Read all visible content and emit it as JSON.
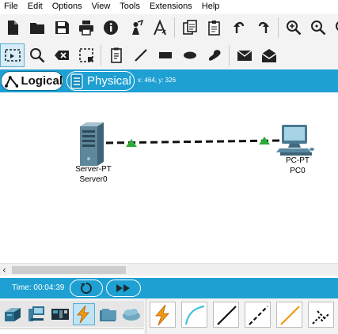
{
  "menu": [
    "File",
    "Edit",
    "Options",
    "View",
    "Tools",
    "Extensions",
    "Help"
  ],
  "toolbar_main": [
    "new-icon",
    "open-icon",
    "save-icon",
    "print-icon",
    "info-icon",
    "network-wizard-icon",
    "activity-wizard-icon",
    "copy-icon",
    "paste-icon",
    "undo-icon",
    "redo-icon",
    "zoom-in-icon",
    "zoom-reset-icon",
    "zoom-out-icon"
  ],
  "toolbar_tools": [
    "select-icon",
    "inspect-icon",
    "delete-icon",
    "resize-icon",
    "note-icon",
    "draw-line-icon",
    "draw-rectangle-icon",
    "draw-ellipse-icon",
    "draw-freeform-icon",
    "add-simple-pdu-icon",
    "add-complex-pdu-icon"
  ],
  "workspace": {
    "logical_label": "Logical",
    "physical_label": "Physical",
    "coords": "x: 464, y: 326"
  },
  "devices": [
    {
      "type": "Server-PT",
      "name": "Server0"
    },
    {
      "type": "PC-PT",
      "name": "PC0"
    }
  ],
  "link": {
    "style": "dashed",
    "color": "#111111",
    "endpoint_color": "#2eaa3a"
  },
  "time": {
    "label": "Time: 00:04:39"
  },
  "device_categories": [
    "network-devices-icon",
    "end-devices-icon",
    "components-icon",
    "connections-icon",
    "miscellaneous-icon",
    "multiuser-icon"
  ],
  "selected_category": "connections-icon",
  "cables": [
    "automatic-cable-icon",
    "console-cable-icon",
    "straight-through-cable-icon",
    "crossover-cable-icon",
    "fiber-cable-icon",
    "phone-cable-icon"
  ],
  "colors": {
    "accent": "#1ea0d2",
    "toolbar": "#f3f3f3",
    "link_green": "#2eaa3a"
  }
}
